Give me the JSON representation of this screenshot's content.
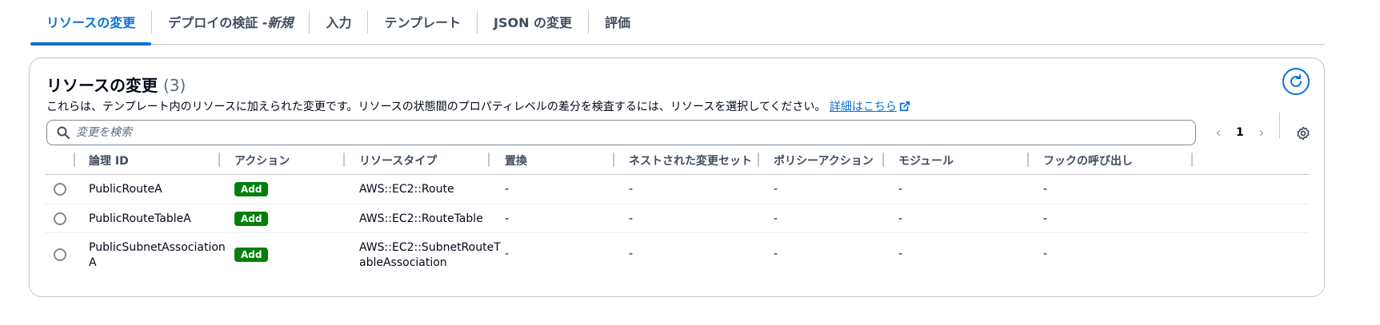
{
  "tabs": [
    {
      "label": "リソースの変更",
      "active": true
    },
    {
      "label": "デプロイの検証 - ",
      "label_em": "新規",
      "active": false
    },
    {
      "label": "入力",
      "active": false
    },
    {
      "label": "テンプレート",
      "active": false
    },
    {
      "label": "JSON の変更",
      "active": false
    },
    {
      "label": "評価",
      "active": false
    }
  ],
  "panel": {
    "title": "リソースの変更",
    "count": "(3)",
    "description": "これらは、テンプレート内のリソースに加えられた変更です。リソースの状態間のプロパティレベルの差分を検査するには、リソースを選択してください。",
    "learn_more": "詳細はこちら"
  },
  "search": {
    "placeholder": "変更を検索",
    "value": ""
  },
  "pagination": {
    "current_page": "1",
    "prev_icon": "chevron-left-icon",
    "next_icon": "chevron-right-icon"
  },
  "table": {
    "columns": [
      "論理 ID",
      "アクション",
      "リソースタイプ",
      "置換",
      "ネストされた変更セット",
      "ポリシーアクション",
      "モジュール",
      "フックの呼び出し"
    ],
    "rows": [
      {
        "logical_id": "PublicRouteA",
        "action": "Add",
        "resource_type": "AWS::EC2::Route",
        "replacement": "-",
        "nested_change_set": "-",
        "policy_action": "-",
        "module": "-",
        "hook_invocation": "-"
      },
      {
        "logical_id": "PublicRouteTableA",
        "action": "Add",
        "resource_type": "AWS::EC2::RouteTable",
        "replacement": "-",
        "nested_change_set": "-",
        "policy_action": "-",
        "module": "-",
        "hook_invocation": "-"
      },
      {
        "logical_id": "PublicSubnetAssociation\nA",
        "action": "Add",
        "resource_type": "AWS::EC2::SubnetRouteT\nableAssociation",
        "replacement": "-",
        "nested_change_set": "-",
        "policy_action": "-",
        "module": "-",
        "hook_invocation": "-"
      }
    ]
  },
  "colors": {
    "accent": "#0972d3",
    "add_badge": "#037f0c",
    "border": "#c6c6cd"
  }
}
